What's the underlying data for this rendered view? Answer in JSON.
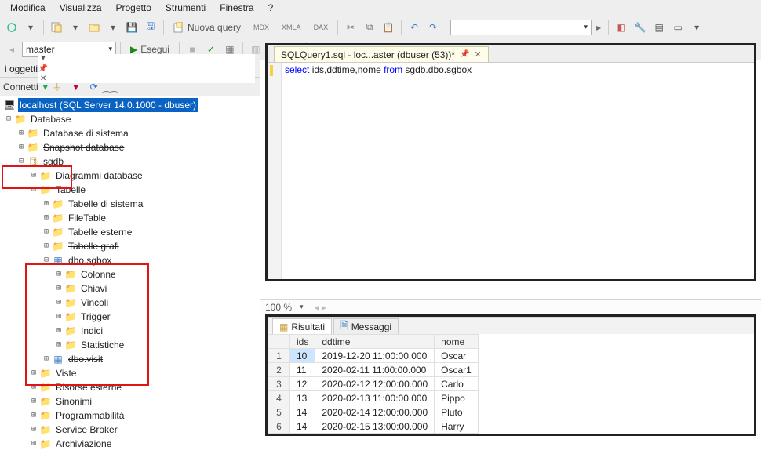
{
  "menu": {
    "modifica": "Modifica",
    "visualizza": "Visualizza",
    "progetto": "Progetto",
    "strumenti": "Strumenti",
    "finestra": "Finestra",
    "help": "?"
  },
  "toolbar1": {
    "nuova_query": "Nuova query",
    "mdx": "MDX",
    "xmla": "XMLA",
    "dax": "DAX"
  },
  "toolbar2": {
    "db_select": "master",
    "esegui": "Esegui"
  },
  "objexp": {
    "title": "i oggetti",
    "connect": "Connetti",
    "server": "localhost (SQL Server 14.0.1000 - dbuser)"
  },
  "tree": {
    "database": "Database",
    "db_sistema": "Database di sistema",
    "snapshot_db": "Snapshot database",
    "sgdb": "sgdb",
    "diagrammi": "Diagrammi database",
    "tabelle": "Tabelle",
    "tab_sistema": "Tabelle di sistema",
    "filetable": "FileTable",
    "tab_esterne": "Tabelle esterne",
    "tab_grafi": "Tabelle grafi",
    "dbo_sgbox": "dbo.sgbox",
    "colonne": "Colonne",
    "chiavi": "Chiavi",
    "vincoli": "Vincoli",
    "trigger": "Trigger",
    "indici": "Indici",
    "statistiche": "Statistiche",
    "dbo_visit": "dbo.visit",
    "viste": "Viste",
    "risorse": "Risorse esterne",
    "sinonimi": "Sinonimi",
    "programm": "Programmabilità",
    "service_broker": "Service Broker",
    "archiviazione": "Archiviazione"
  },
  "sql_tab": {
    "title": "SQLQuery1.sql - loc...aster (dbuser (53))*"
  },
  "sql": {
    "select": "select",
    "cols": " ids,ddtime,nome ",
    "from": "from",
    "target": " sgdb.dbo.sgbox"
  },
  "zoom": {
    "value": "100 %"
  },
  "results": {
    "tab_risultati": "Risultati",
    "tab_messaggi": "Messaggi",
    "columns": [
      "",
      "ids",
      "ddtime",
      "nome"
    ],
    "rows": [
      [
        "1",
        "10",
        "2019-12-20 11:00:00.000",
        "Oscar"
      ],
      [
        "2",
        "11",
        "2020-02-11 11:00:00.000",
        "Oscar1"
      ],
      [
        "3",
        "12",
        "2020-02-12 12:00:00.000",
        "Carlo"
      ],
      [
        "4",
        "13",
        "2020-02-13 11:00:00.000",
        "Pippo"
      ],
      [
        "5",
        "14",
        "2020-02-14 12:00:00.000",
        "Pluto"
      ],
      [
        "6",
        "14",
        "2020-02-15 13:00:00.000",
        "Harry"
      ]
    ]
  }
}
